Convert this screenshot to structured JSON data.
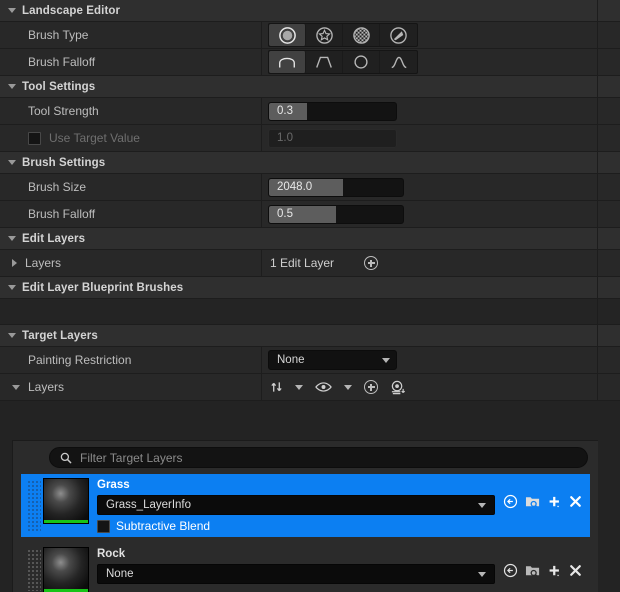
{
  "panel": {
    "title": "Landscape Editor"
  },
  "brush_type": {
    "label": "Brush Type",
    "options": [
      "circle-brush-icon",
      "alpha-brush-icon",
      "pattern-brush-icon",
      "gizmo-brush-icon"
    ],
    "selected_index": 0
  },
  "brush_falloff_type": {
    "label": "Brush Falloff",
    "options": [
      "smooth-falloff-icon",
      "linear-falloff-icon",
      "spherical-falloff-icon",
      "tip-falloff-icon"
    ],
    "selected_index": 0
  },
  "tool_settings": {
    "title": "Tool Settings",
    "tool_strength": {
      "label": "Tool Strength",
      "value": "0.3",
      "fill_percent": 30
    },
    "use_target_value": {
      "label": "Use Target Value",
      "checked": false,
      "value": "1.0",
      "fill_percent": 0
    }
  },
  "brush_settings": {
    "title": "Brush Settings",
    "brush_size": {
      "label": "Brush Size",
      "value": "2048.0",
      "fill_percent": 55
    },
    "brush_falloff": {
      "label": "Brush Falloff",
      "value": "0.5",
      "fill_percent": 50
    }
  },
  "edit_layers": {
    "title": "Edit Layers",
    "layers_row": {
      "label": "Layers",
      "value": "1 Edit Layer",
      "add_icon": "plus-circle-icon"
    }
  },
  "edit_layer_blueprint_brushes": {
    "title": "Edit Layer Blueprint Brushes"
  },
  "target_layers": {
    "title": "Target Layers",
    "painting_restriction": {
      "label": "Painting Restriction",
      "value": "None"
    },
    "layers_row": {
      "label": "Layers",
      "toolbar": [
        "sort-icon",
        "sort-dropdown-chevron-icon",
        "visibility-eye-icon",
        "visibility-dropdown-chevron-icon",
        "add-layer-plus-icon",
        "create-layer-info-icon"
      ]
    },
    "filter": {
      "placeholder": "Filter Target Layers",
      "value": "",
      "icon": "search-icon"
    },
    "items": [
      {
        "name": "Grass",
        "layer_info": "Grass_LayerInfo",
        "selected": true,
        "subtractive_blend": {
          "label": "Subtractive Blend",
          "checked": false
        },
        "actions": [
          "revert-icon",
          "browse-asset-icon",
          "add-asset-icon",
          "remove-layer-icon"
        ],
        "thumbnail": "material-sphere-thumbnail"
      },
      {
        "name": "Rock",
        "layer_info": "None",
        "selected": false,
        "actions": [
          "revert-icon",
          "browse-asset-icon",
          "add-asset-icon",
          "remove-layer-icon"
        ],
        "thumbnail": "material-sphere-thumbnail"
      }
    ]
  },
  "colors": {
    "selection": "#0c7ff2",
    "panel_bg": "#232323",
    "header_bg": "#2f2f2f",
    "row_bg": "#282828"
  }
}
